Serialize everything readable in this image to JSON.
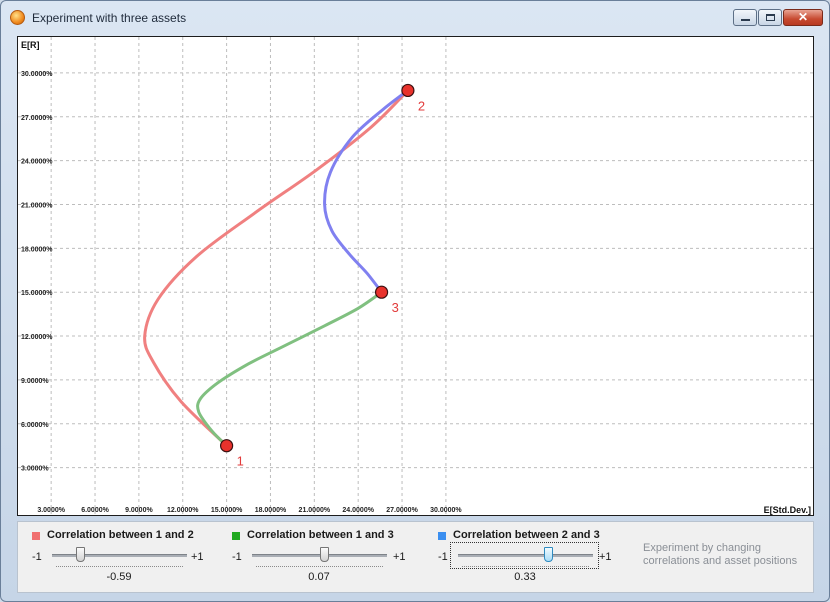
{
  "window": {
    "title": "Experiment with three assets",
    "close_glyph": "✕"
  },
  "chart_data": {
    "type": "line",
    "ylabel": "E[R]",
    "xlabel": "E[Std.Dev.]",
    "x_ticks": [
      "3.0000%",
      "6.0000%",
      "9.0000%",
      "12.0000%",
      "15.0000%",
      "18.0000%",
      "21.0000%",
      "24.0000%",
      "27.0000%",
      "30.0000%"
    ],
    "y_ticks": [
      "3.0000%",
      "6.0000%",
      "9.0000%",
      "12.0000%",
      "15.0000%",
      "18.0000%",
      "21.0000%",
      "24.0000%",
      "27.0000%",
      "30.0000%"
    ],
    "xlim": [
      0,
      32
    ],
    "ylim": [
      0,
      32
    ],
    "grid": true,
    "assets": [
      {
        "label": "1",
        "std": 15.0,
        "ret": 4.5
      },
      {
        "label": "2",
        "std": 27.4,
        "ret": 28.8
      },
      {
        "label": "3",
        "std": 25.6,
        "ret": 15.0
      }
    ],
    "series": [
      {
        "pair": "1-2",
        "color": "#f08080",
        "correlation": -0.59,
        "points": [
          [
            15.0,
            4.5
          ],
          [
            11.9,
            7.5
          ],
          [
            10.0,
            10.2
          ],
          [
            9.4,
            12.0
          ],
          [
            10.3,
            14.5
          ],
          [
            12.9,
            17.4
          ],
          [
            16.9,
            20.4
          ],
          [
            21.2,
            23.4
          ],
          [
            24.9,
            26.3
          ],
          [
            27.4,
            28.8
          ]
        ]
      },
      {
        "pair": "1-3",
        "color": "#80c080",
        "correlation": 0.07,
        "points": [
          [
            15.0,
            4.5
          ],
          [
            14.0,
            5.5
          ],
          [
            13.1,
            6.8
          ],
          [
            13.2,
            7.7
          ],
          [
            14.4,
            8.8
          ],
          [
            16.5,
            10.1
          ],
          [
            19.1,
            11.4
          ],
          [
            21.7,
            12.7
          ],
          [
            24.0,
            13.9
          ],
          [
            25.6,
            15.0
          ]
        ]
      },
      {
        "pair": "2-3",
        "color": "#8080f0",
        "correlation": 0.33,
        "points": [
          [
            27.4,
            28.8
          ],
          [
            25.7,
            27.5
          ],
          [
            23.6,
            25.6
          ],
          [
            22.1,
            23.2
          ],
          [
            21.7,
            21.0
          ],
          [
            22.2,
            19.2
          ],
          [
            23.4,
            17.6
          ],
          [
            24.6,
            16.3
          ],
          [
            25.6,
            15.0
          ]
        ]
      }
    ]
  },
  "panel": {
    "sliders": [
      {
        "label": "Correlation between 1 and 2",
        "color": "#f07070",
        "min_label": "-1",
        "max_label": "+1",
        "value": -0.59,
        "value_text": "-0.59"
      },
      {
        "label": "Correlation between 1 and 3",
        "color": "#22aa22",
        "min_label": "-1",
        "max_label": "+1",
        "value": 0.07,
        "value_text": "0.07"
      },
      {
        "label": "Correlation between 2 and 3",
        "color": "#3b8ff0",
        "min_label": "-1",
        "max_label": "+1",
        "value": 0.33,
        "value_text": "0.33"
      }
    ],
    "hint": "Experiment by changing correlations and asset positions"
  }
}
